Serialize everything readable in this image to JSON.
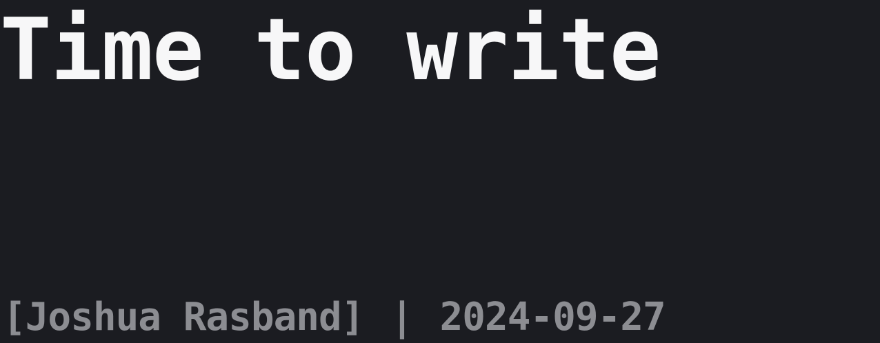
{
  "post": {
    "title": "Time to write",
    "author_display": "[Joshua Rasband]",
    "separator": "|",
    "date": "2024-09-27"
  },
  "colors": {
    "background": "#1b1c21",
    "title": "#f7f7f8",
    "meta": "#8c8d92"
  }
}
